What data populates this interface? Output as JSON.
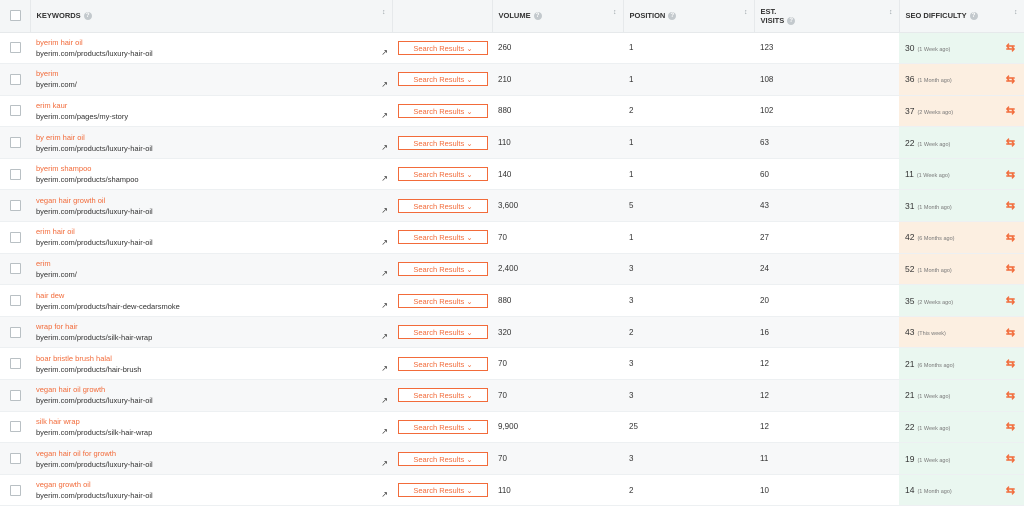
{
  "headers": {
    "keywords": "KEYWORDS",
    "volume": "VOLUME",
    "position": "POSITION",
    "est_visits_1": "EST.",
    "est_visits_2": "VISITS",
    "seo_difficulty": "SEO DIFFICULTY",
    "info_icon": "?",
    "sort_icon": "↕"
  },
  "search_results_label": "Search Results ⌄",
  "icons": {
    "external": "external-link-icon",
    "refresh": "refresh-icon"
  },
  "colors": {
    "accent": "#f26b3a",
    "easy": "#eaf7f0",
    "hard": "#fcefe1"
  },
  "rows": [
    {
      "keyword": "byerim hair oil",
      "url": "byerim.com/products/luxury-hair-oil",
      "volume": "260",
      "position": "1",
      "visits": "123",
      "difficulty": "30",
      "ago": "(1 Week ago)",
      "level": "easy"
    },
    {
      "keyword": "byerim",
      "url": "byerim.com/",
      "volume": "210",
      "position": "1",
      "visits": "108",
      "difficulty": "36",
      "ago": "(1 Month ago)",
      "level": "hard"
    },
    {
      "keyword": "erim kaur",
      "url": "byerim.com/pages/my-story",
      "volume": "880",
      "position": "2",
      "visits": "102",
      "difficulty": "37",
      "ago": "(2 Weeks ago)",
      "level": "hard"
    },
    {
      "keyword": "by erim hair oil",
      "url": "byerim.com/products/luxury-hair-oil",
      "volume": "110",
      "position": "1",
      "visits": "63",
      "difficulty": "22",
      "ago": "(1 Week ago)",
      "level": "easy"
    },
    {
      "keyword": "byerim shampoo",
      "url": "byerim.com/products/shampoo",
      "volume": "140",
      "position": "1",
      "visits": "60",
      "difficulty": "11",
      "ago": "(1 Week ago)",
      "level": "easy"
    },
    {
      "keyword": "vegan hair growth oil",
      "url": "byerim.com/products/luxury-hair-oil",
      "volume": "3,600",
      "position": "5",
      "visits": "43",
      "difficulty": "31",
      "ago": "(1 Month ago)",
      "level": "easy"
    },
    {
      "keyword": "erim hair oil",
      "url": "byerim.com/products/luxury-hair-oil",
      "volume": "70",
      "position": "1",
      "visits": "27",
      "difficulty": "42",
      "ago": "(6 Months ago)",
      "level": "hard"
    },
    {
      "keyword": "erim",
      "url": "byerim.com/",
      "volume": "2,400",
      "position": "3",
      "visits": "24",
      "difficulty": "52",
      "ago": "(1 Month ago)",
      "level": "hard"
    },
    {
      "keyword": "hair dew",
      "url": "byerim.com/products/hair-dew-cedarsmoke",
      "volume": "880",
      "position": "3",
      "visits": "20",
      "difficulty": "35",
      "ago": "(2 Weeks ago)",
      "level": "easy"
    },
    {
      "keyword": "wrap for hair",
      "url": "byerim.com/products/silk-hair-wrap",
      "volume": "320",
      "position": "2",
      "visits": "16",
      "difficulty": "43",
      "ago": "(This week)",
      "level": "hard"
    },
    {
      "keyword": "boar bristle brush halal",
      "url": "byerim.com/products/hair-brush",
      "volume": "70",
      "position": "3",
      "visits": "12",
      "difficulty": "21",
      "ago": "(6 Months ago)",
      "level": "easy"
    },
    {
      "keyword": "vegan hair oil growth",
      "url": "byerim.com/products/luxury-hair-oil",
      "volume": "70",
      "position": "3",
      "visits": "12",
      "difficulty": "21",
      "ago": "(1 Week ago)",
      "level": "easy"
    },
    {
      "keyword": "silk hair wrap",
      "url": "byerim.com/products/silk-hair-wrap",
      "volume": "9,900",
      "position": "25",
      "visits": "12",
      "difficulty": "22",
      "ago": "(1 Week ago)",
      "level": "easy"
    },
    {
      "keyword": "vegan hair oil for growth",
      "url": "byerim.com/products/luxury-hair-oil",
      "volume": "70",
      "position": "3",
      "visits": "11",
      "difficulty": "19",
      "ago": "(1 Week ago)",
      "level": "easy"
    },
    {
      "keyword": "vegan growth oil",
      "url": "byerim.com/products/luxury-hair-oil",
      "volume": "110",
      "position": "2",
      "visits": "10",
      "difficulty": "14",
      "ago": "(1 Month ago)",
      "level": "easy"
    }
  ]
}
